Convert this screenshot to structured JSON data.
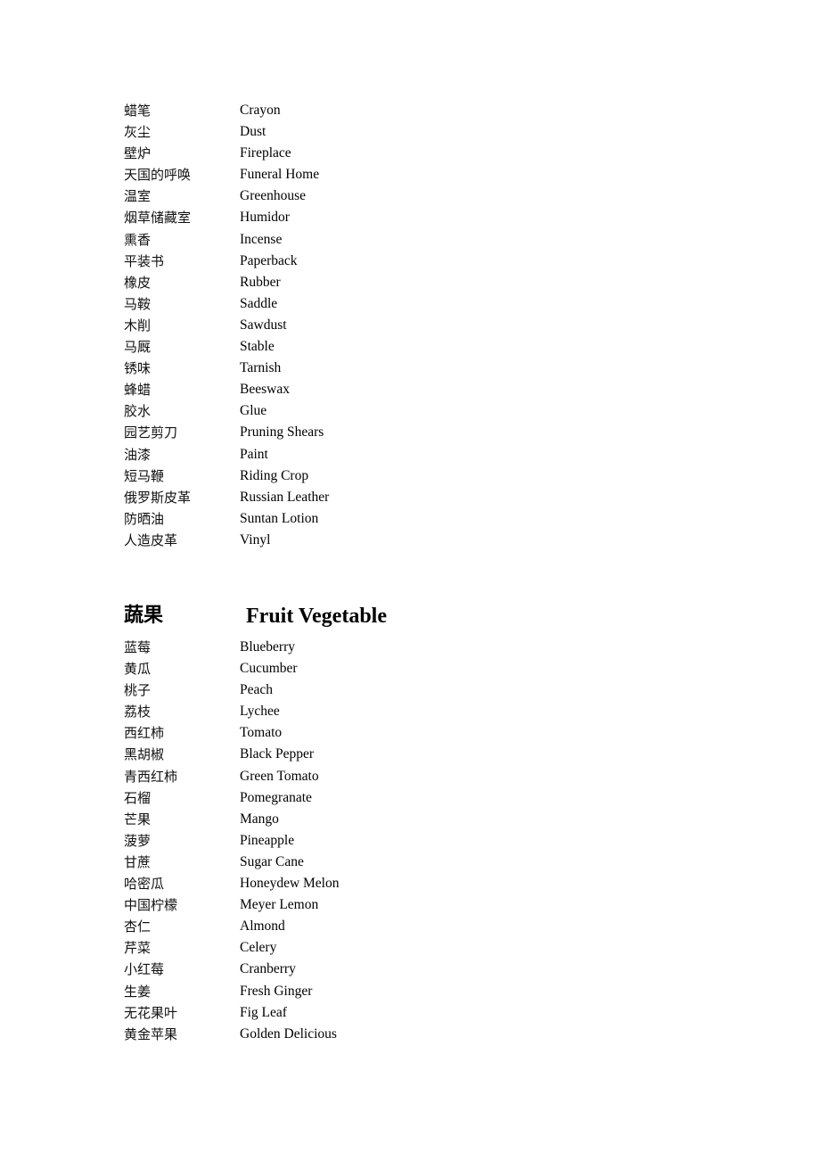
{
  "section1": {
    "items": [
      {
        "cn": "蜡笔",
        "en": "Crayon"
      },
      {
        "cn": "灰尘",
        "en": "Dust"
      },
      {
        "cn": "壁炉",
        "en": "Fireplace"
      },
      {
        "cn": "天国的呼唤",
        "en": "Funeral Home"
      },
      {
        "cn": "温室",
        "en": "Greenhouse"
      },
      {
        "cn": "烟草储藏室",
        "en": "Humidor"
      },
      {
        "cn": "熏香",
        "en": "Incense"
      },
      {
        "cn": "平装书",
        "en": "Paperback"
      },
      {
        "cn": "橡皮",
        "en": "Rubber"
      },
      {
        "cn": "马鞍",
        "en": "Saddle"
      },
      {
        "cn": "木削",
        "en": "Sawdust"
      },
      {
        "cn": "马厩",
        "en": "Stable"
      },
      {
        "cn": "锈味",
        "en": "Tarnish"
      },
      {
        "cn": "蜂蜡",
        "en": "Beeswax"
      },
      {
        "cn": "胶水",
        "en": "Glue"
      },
      {
        "cn": "园艺剪刀",
        "en": "Pruning Shears"
      },
      {
        "cn": "油漆",
        "en": "Paint"
      },
      {
        "cn": "短马鞭",
        "en": "Riding Crop"
      },
      {
        "cn": "俄罗斯皮革",
        "en": "Russian Leather"
      },
      {
        "cn": "防晒油",
        "en": "Suntan Lotion"
      },
      {
        "cn": "人造皮革",
        "en": "Vinyl"
      }
    ]
  },
  "section2": {
    "heading_cn": "蔬果",
    "heading_en": "Fruit Vegetable",
    "items": [
      {
        "cn": "蓝莓",
        "en": "Blueberry"
      },
      {
        "cn": "黄瓜",
        "en": "Cucumber"
      },
      {
        "cn": "桃子",
        "en": "Peach"
      },
      {
        "cn": "荔枝",
        "en": "Lychee"
      },
      {
        "cn": "西红柿",
        "en": "Tomato"
      },
      {
        "cn": "黑胡椒",
        "en": "Black Pepper"
      },
      {
        "cn": "青西红柿",
        "en": "Green Tomato"
      },
      {
        "cn": "石榴",
        "en": "Pomegranate"
      },
      {
        "cn": "芒果",
        "en": "Mango"
      },
      {
        "cn": "菠萝",
        "en": "Pineapple"
      },
      {
        "cn": "甘蔗",
        "en": "Sugar Cane"
      },
      {
        "cn": "哈密瓜",
        "en": "Honeydew Melon"
      },
      {
        "cn": "中国柠檬",
        "en": "Meyer Lemon"
      },
      {
        "cn": "杏仁",
        "en": "Almond"
      },
      {
        "cn": "芹菜",
        "en": "Celery"
      },
      {
        "cn": "小红莓",
        "en": "Cranberry"
      },
      {
        "cn": "生姜",
        "en": "Fresh Ginger"
      },
      {
        "cn": "无花果叶",
        "en": "Fig Leaf"
      },
      {
        "cn": "黄金苹果",
        "en": "Golden Delicious"
      }
    ]
  }
}
